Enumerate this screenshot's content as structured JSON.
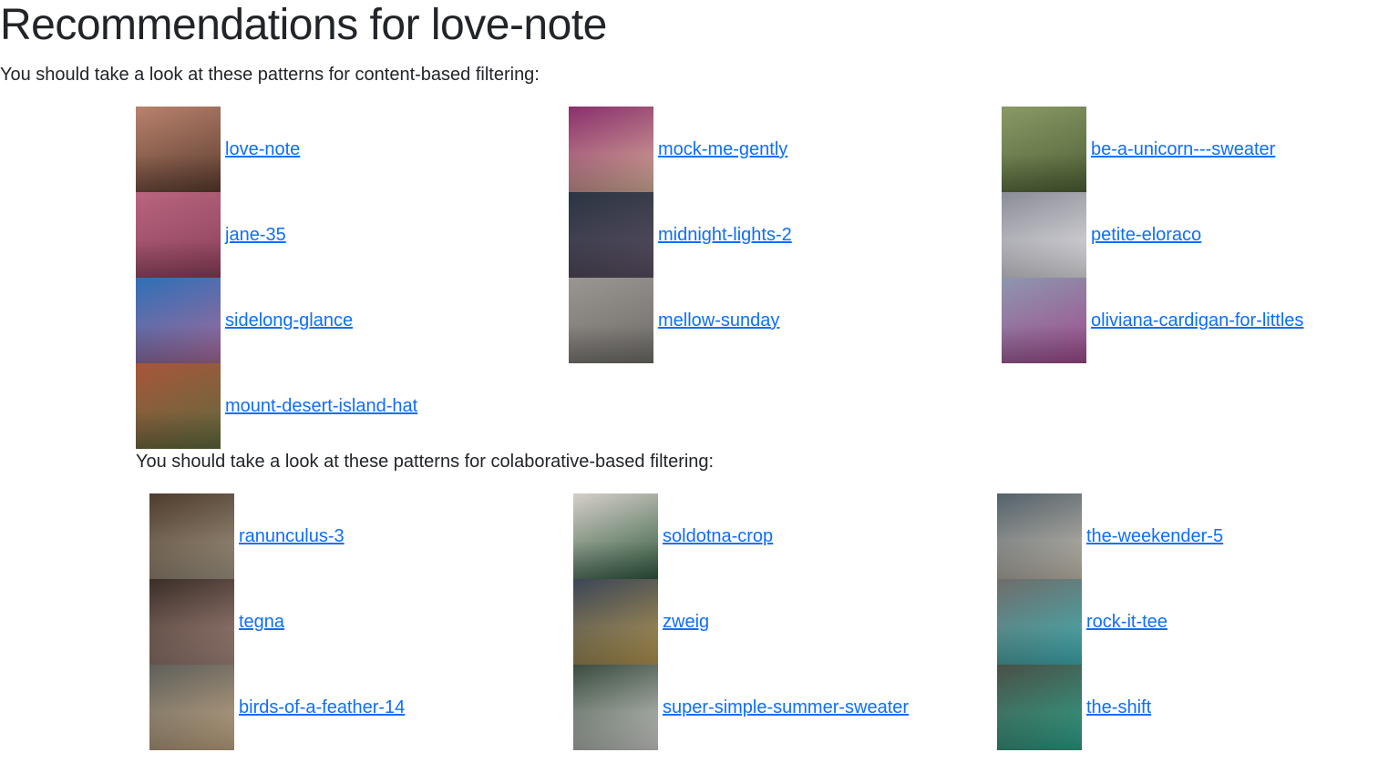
{
  "page": {
    "title": "Recommendations for love-note",
    "content_intro": "You should take a look at these patterns for content-based filtering:",
    "collab_intro": "You should take a look at these patterns for colaborative-based filtering:"
  },
  "link_color": "#0d6efd",
  "content_based": [
    {
      "name": "love-note",
      "colors": [
        "#b9826e",
        "#5a3c2d"
      ]
    },
    {
      "name": "mock-me-gently",
      "colors": [
        "#8a2f6c",
        "#d9b29a"
      ]
    },
    {
      "name": "be-a-unicorn---sweater",
      "colors": [
        "#8a9a66",
        "#4d6035"
      ]
    },
    {
      "name": "jane-35",
      "colors": [
        "#b9657f",
        "#8a3f5a"
      ]
    },
    {
      "name": "midnight-lights-2",
      "colors": [
        "#2b3542",
        "#5c4f63"
      ]
    },
    {
      "name": "petite-eloraco",
      "colors": [
        "#8a8c96",
        "#e6e4e8"
      ]
    },
    {
      "name": "sidelong-glance",
      "colors": [
        "#2f6fb7",
        "#a86a98"
      ]
    },
    {
      "name": "mellow-sunday",
      "colors": [
        "#9a9691",
        "#6f6c68"
      ]
    },
    {
      "name": "oliviana-cardigan-for-littles",
      "colors": [
        "#8d97ae",
        "#a04a8c"
      ]
    },
    {
      "name": "mount-desert-island-hat",
      "colors": [
        "#a8563a",
        "#5d6b3e"
      ]
    }
  ],
  "collaborative": [
    {
      "name": "ranunculus-3",
      "colors": [
        "#4e3b2c",
        "#a59a86"
      ]
    },
    {
      "name": "soldotna-crop",
      "colors": [
        "#d6cfc8",
        "#2f5a3f"
      ]
    },
    {
      "name": "the-weekender-5",
      "colors": [
        "#53616a",
        "#c9c0b2"
      ]
    },
    {
      "name": "tegna",
      "colors": [
        "#3b2d28",
        "#a88a80"
      ]
    },
    {
      "name": "zweig",
      "colors": [
        "#3b4656",
        "#b89a52"
      ]
    },
    {
      "name": "rock-it-tee",
      "colors": [
        "#6f6d6a",
        "#3fb1b5"
      ]
    },
    {
      "name": "birds-of-a-feather-14",
      "colors": [
        "#5e5f5b",
        "#c4a884"
      ]
    },
    {
      "name": "super-simple-summer-sweater",
      "colors": [
        "#3a4c3f",
        "#cfd0cc"
      ]
    },
    {
      "name": "the-shift",
      "colors": [
        "#4a5047",
        "#2fa38a"
      ]
    }
  ]
}
